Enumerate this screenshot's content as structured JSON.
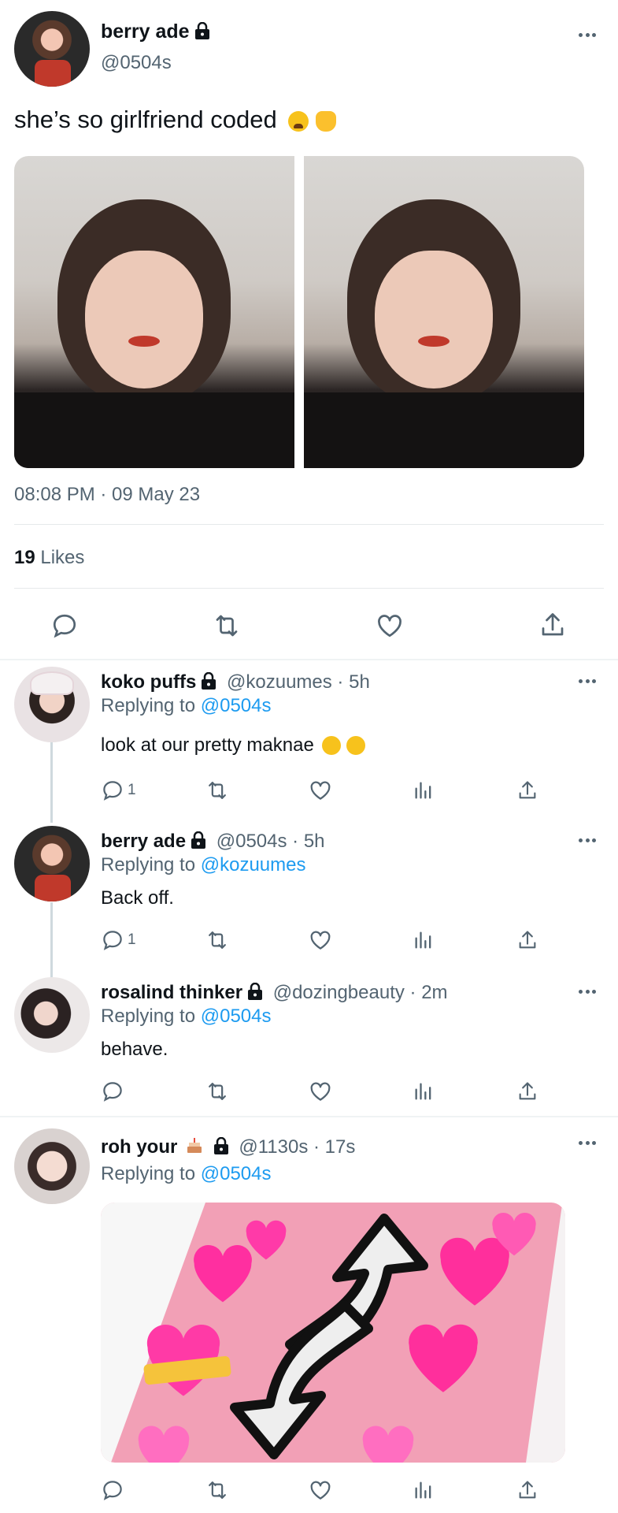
{
  "main_tweet": {
    "author_name": "berry ade",
    "handle": "@0504s",
    "text": "she’s so girlfriend coded",
    "timestamp": "08:08 PM · 09 May 23",
    "likes_count": "19",
    "likes_label": "Likes"
  },
  "replies": [
    {
      "author_name": "koko puffs",
      "meta": "@kozuumes · 5h",
      "replying_prefix": "Replying to",
      "replying_to": "@0504s",
      "text": "look at our pretty maknae",
      "reply_count": "1"
    },
    {
      "author_name": "berry ade",
      "meta": "@0504s · 5h",
      "replying_prefix": "Replying to",
      "replying_to": "@kozuumes",
      "text": "Back off.",
      "reply_count": "1"
    },
    {
      "author_name": "rosalind thinker",
      "meta": "@dozingbeauty · 2m",
      "replying_prefix": "Replying to",
      "replying_to": "@0504s",
      "text": "behave."
    },
    {
      "author_name": "roh your",
      "meta": "@1130s · 17s",
      "replying_prefix": "Replying to",
      "replying_to": "@0504s"
    }
  ],
  "colors": {
    "link": "#1d9bf0",
    "secondary_text": "#536471",
    "divider": "#eff3f4",
    "card_pink": "#f2a0b6"
  }
}
